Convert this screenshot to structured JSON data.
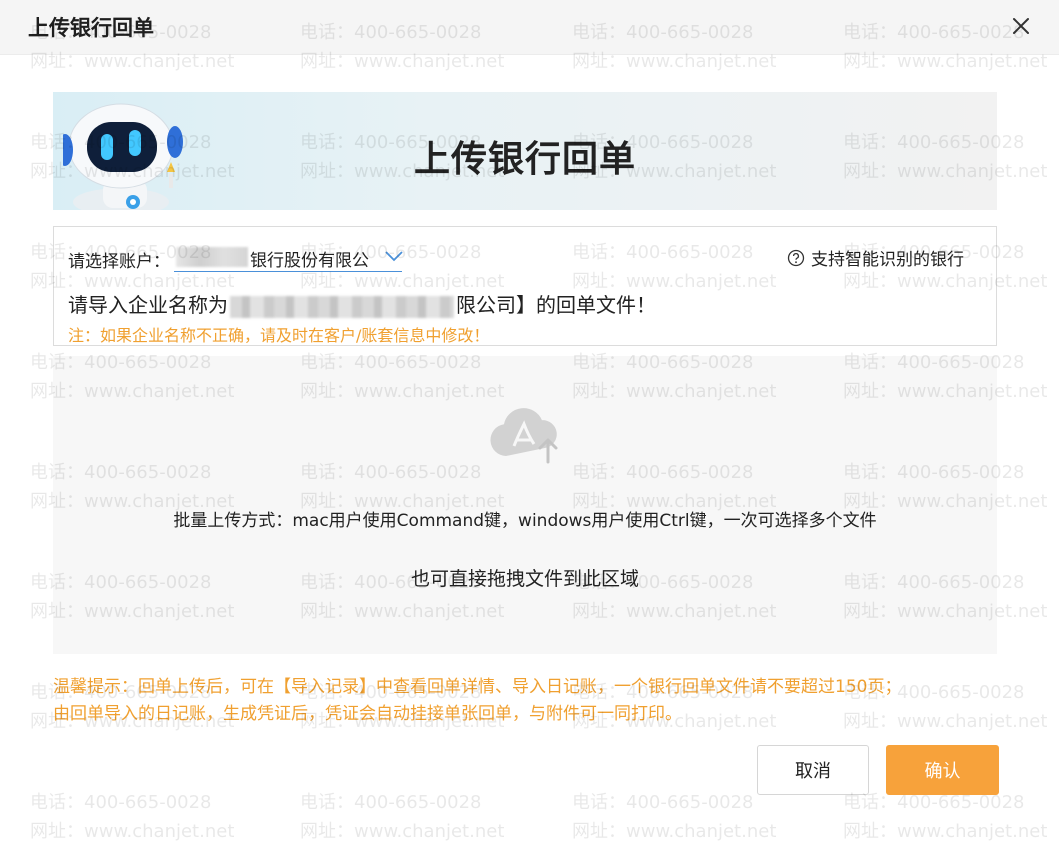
{
  "dialog": {
    "title": "上传银行回单",
    "close_icon": "close-icon"
  },
  "banner": {
    "title": "上传银行回单",
    "mascot": "robot-mascot"
  },
  "account": {
    "label": "请选择账户：",
    "selected_value": "银行股份有限公",
    "support_link": "支持智能识别的银行",
    "import_prefix": "请导入企业名称为",
    "import_suffix": "限公司】的回单文件！",
    "note": "注：如果企业名称不正确，请及时在客户/账套信息中修改！"
  },
  "upload": {
    "icon": "upload-file-icon",
    "batch_hint": "批量上传方式：mac用户使用Command键，windows用户使用Ctrl键，一次可选择多个文件",
    "drag_hint": "也可直接拖拽文件到此区域"
  },
  "tips": {
    "line1": "温馨提示：回单上传后，可在【导入记录】中查看回单详情、导入日记账，一个银行回单文件请不要超过150页；",
    "line2": "由回单导入的日记账，生成凭证后，凭证会自动挂接单张回单，与附件可一同打印。"
  },
  "buttons": {
    "cancel": "取消",
    "confirm": "确认"
  },
  "watermark": {
    "phone": "电话：400-665-0028",
    "site": "网址：www.chanjet.net"
  },
  "colors": {
    "accent": "#f7a23b",
    "warning_text": "#f0a030",
    "select_underline": "#4a90d9"
  }
}
